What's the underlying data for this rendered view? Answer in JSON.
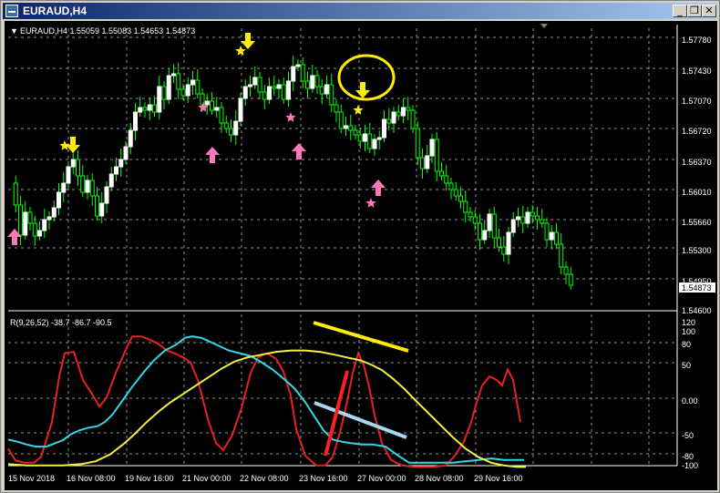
{
  "window": {
    "title": "EURAUD,H4",
    "minimize_icon": "minimize-icon",
    "restore_icon": "restore-icon",
    "close_icon": "close-icon"
  },
  "chart": {
    "header": "EURAUD,H4  1.55059 1.55083 1.54653 1.54873",
    "current_price_label": "1.54873",
    "price_ticks": [
      "1.57780",
      "1.57430",
      "1.57070",
      "1.56720",
      "1.56370",
      "1.56010",
      "1.55660",
      "1.55300",
      "1.54950",
      "1.54600"
    ],
    "time_ticks": [
      "15 Nov 2018",
      "16 Nov 08:00",
      "19 Nov 16:00",
      "21 Nov 00:00",
      "22 Nov 08:00",
      "23 Nov 16:00",
      "27 Nov 00:00",
      "28 Nov 08:00",
      "29 Nov 16:00"
    ],
    "colors": {
      "background": "#000000",
      "bull_candle": "#ffffff",
      "bear_candle": "#00ff00",
      "grid": "#c0c0c0",
      "signal_up": "#ff77bb",
      "signal_down": "#ffee00",
      "osc_fast": "#e82020",
      "osc_mid": "#30d8e8",
      "osc_slow": "#f0f040"
    },
    "signal_icons": {
      "up": "up-arrow-icon",
      "down": "down-arrow-icon",
      "star": "star-icon"
    }
  },
  "indicator": {
    "label": "R(9,26,52) -38.7 -86.7 -90.5",
    "level_ticks": [
      "120",
      "100",
      "80",
      "50",
      "0.00",
      "-50",
      "-80",
      "-100"
    ]
  }
}
